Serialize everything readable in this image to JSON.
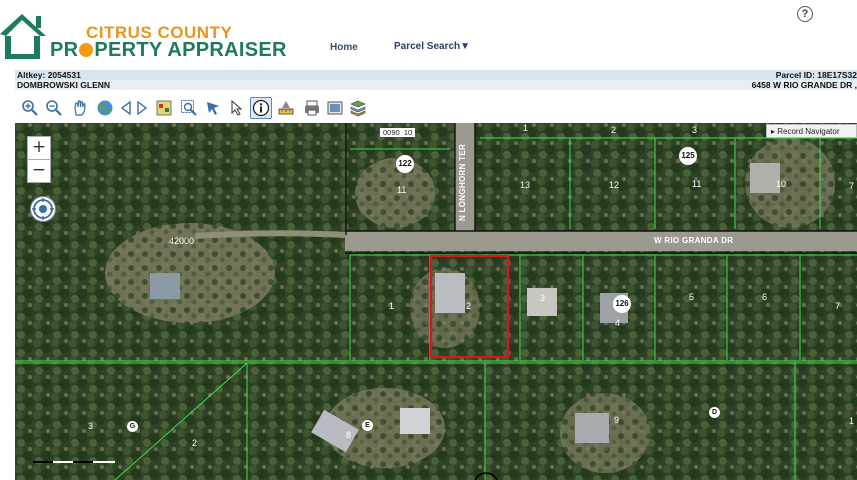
{
  "logo": {
    "line1": "CITRUS COUNTY",
    "line2_a": "PR",
    "line2_b": "PERTY APPRAISER"
  },
  "nav": {
    "home": "Home",
    "parcel_search": "Parcel Search▼"
  },
  "help": "?",
  "info": {
    "altkey": "Altkey: 2054531",
    "owner": "DOMBROWSKI GLENN",
    "parcel_id": "Parcel ID: 18E17S32",
    "address": "6458 W RIO GRANDE DR ,"
  },
  "toolbar": {
    "tools": [
      "zoom-in-icon",
      "zoom-out-icon",
      "pan-hand-icon",
      "globe-icon",
      "previous-extent-icon",
      "next-extent-icon",
      "layers-icon",
      "zoom-box-icon",
      "select-icon",
      "identify-arrow-icon",
      "info-icon",
      "measure-icon",
      "print-icon",
      "export-icon",
      "stack-icon"
    ],
    "active": "info-icon"
  },
  "map": {
    "zoom_in": "+",
    "zoom_out": "−",
    "record_navigator": "▸ Record Navigator",
    "roads": {
      "rio_granda": "W RIO GRANDA DR",
      "longhorn": "N LONGHORN TER"
    },
    "tag_0090": "0090",
    "tag_0090_num": "10",
    "badges": [
      {
        "text": "122",
        "size": "big"
      },
      {
        "text": "125",
        "size": "big"
      },
      {
        "text": "126",
        "size": "big"
      },
      {
        "text": "G",
        "size": "small"
      },
      {
        "text": "E",
        "size": "small"
      },
      {
        "text": "D",
        "size": "small"
      }
    ],
    "lots": [
      "11",
      "13",
      "12",
      "11",
      "10",
      "7",
      "42000",
      "1",
      "2",
      "3",
      "4",
      "5",
      "6",
      "7",
      "3",
      "2",
      "8",
      "9",
      "1",
      "1",
      "2",
      "3"
    ]
  }
}
